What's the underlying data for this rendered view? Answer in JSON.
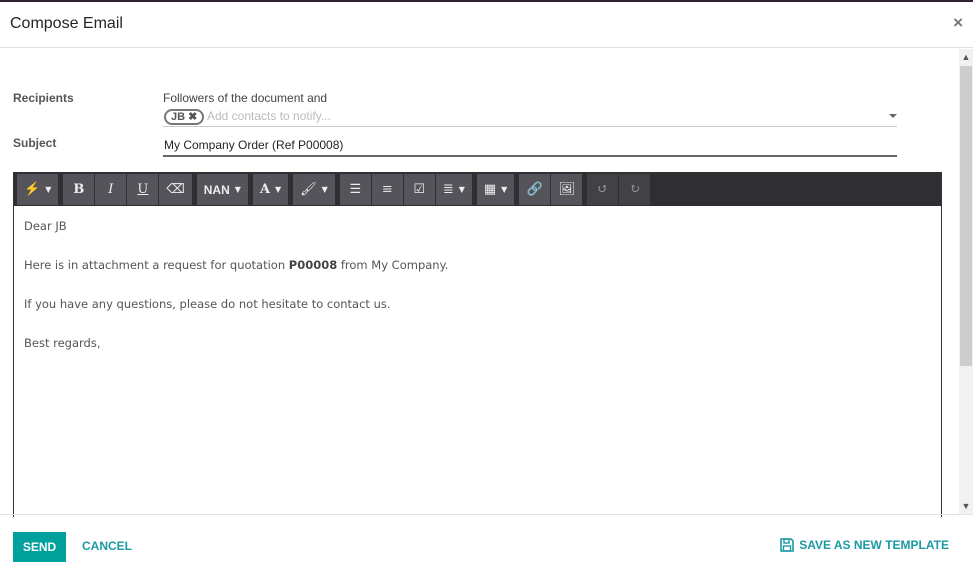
{
  "dialog": {
    "title": "Compose Email",
    "close_icon": "close-icon"
  },
  "form": {
    "recipients_label": "Recipients",
    "followers_text": "Followers of the document and",
    "recipient_tags": [
      {
        "label": "JB",
        "remove_icon": "x-icon"
      }
    ],
    "recipients_placeholder": "Add contacts to notify...",
    "subject_label": "Subject",
    "subject_value": "My Company Order (Ref P00008)"
  },
  "toolbar": {
    "groups": [
      [
        {
          "icon": "magic-wand-icon",
          "dropdown": true
        }
      ],
      [
        {
          "label": "B",
          "icon": "bold-icon"
        },
        {
          "label": "I",
          "icon": "italic-icon"
        },
        {
          "label": "U",
          "icon": "underline-icon"
        },
        {
          "icon": "eraser-icon"
        }
      ],
      [
        {
          "label": "NAN",
          "icon": "font-size-icon",
          "dropdown": true
        }
      ],
      [
        {
          "label": "A",
          "icon": "font-color-icon",
          "dropdown": true
        }
      ],
      [
        {
          "icon": "paint-brush-icon",
          "dropdown": true
        }
      ],
      [
        {
          "icon": "bullet-list-icon"
        },
        {
          "icon": "numbered-list-icon"
        },
        {
          "icon": "checklist-icon"
        },
        {
          "icon": "align-icon",
          "dropdown": true
        }
      ],
      [
        {
          "icon": "table-icon",
          "dropdown": true
        }
      ],
      [
        {
          "icon": "link-icon"
        },
        {
          "icon": "image-icon"
        }
      ],
      [
        {
          "icon": "undo-icon",
          "disabled": true
        },
        {
          "icon": "redo-icon",
          "disabled": true
        }
      ]
    ],
    "font_size_label": "NAN",
    "bold": "B",
    "italic": "I",
    "underline": "U",
    "font_color": "A"
  },
  "body": {
    "greeting": "Dear JB",
    "line1_before": "Here is in attachment a request for quotation ",
    "line1_bold": "P00008",
    "line1_after": " from My Company.",
    "line2": "If you have any questions, please do not hesitate to contact us.",
    "closing": "Best regards,"
  },
  "footer": {
    "send_label": "SEND",
    "cancel_label": "CANCEL",
    "save_template_label": "SAVE AS NEW TEMPLATE"
  },
  "colors": {
    "primary": "#00a09d",
    "link": "#1b9aa3",
    "toolbar_bg": "#2e2e33",
    "toolbar_button": "#54545a"
  }
}
